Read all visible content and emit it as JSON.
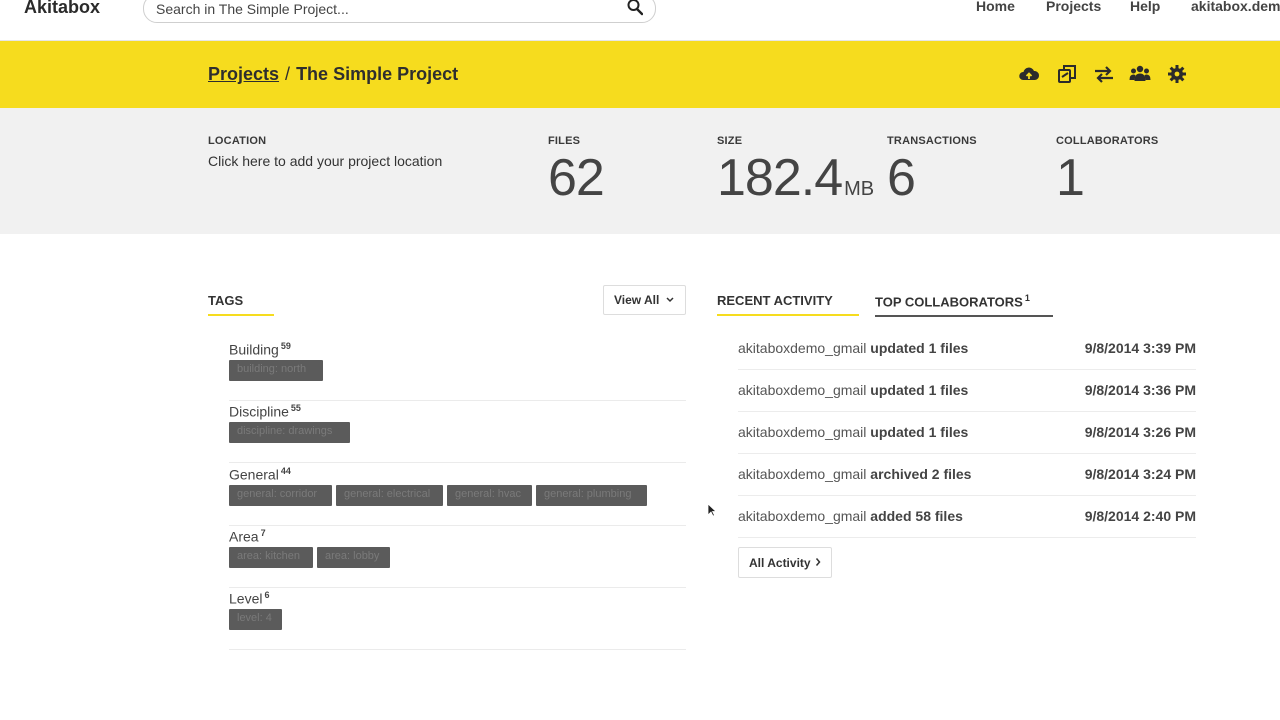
{
  "header": {
    "brand": "Akitabox",
    "search_placeholder": "Search in The Simple Project...",
    "nav": [
      "Home",
      "Projects",
      "Help",
      "akitabox.demo"
    ]
  },
  "breadcrumb": {
    "projects_link": "Projects",
    "separator": "/",
    "current": "The Simple Project"
  },
  "toolbar": {
    "icons": [
      "cloud-upload-icon",
      "copy-icon",
      "transfer-icon",
      "users-icon",
      "gear-icon"
    ]
  },
  "stats": {
    "location_label": "LOCATION",
    "location_value": "Click here to add your project location",
    "files_label": "FILES",
    "files_value": "62",
    "size_label": "SIZE",
    "size_value": "182.4",
    "size_unit": "MB",
    "transactions_label": "TRANSACTIONS",
    "transactions_value": "6",
    "collaborators_label": "COLLABORATORS",
    "collaborators_value": "1"
  },
  "tags": {
    "title": "TAGS",
    "view_all": "View All",
    "groups": [
      {
        "name": "Building",
        "count": "59",
        "chips": [
          "building: north"
        ]
      },
      {
        "name": "Discipline",
        "count": "55",
        "chips": [
          "discipline: drawings"
        ]
      },
      {
        "name": "General",
        "count": "44",
        "chips": [
          "general: corridor",
          "general: electrical",
          "general: hvac",
          "general: plumbing"
        ]
      },
      {
        "name": "Area",
        "count": "7",
        "chips": [
          "area: kitchen",
          "area: lobby"
        ]
      },
      {
        "name": "Level",
        "count": "6",
        "chips": [
          "level: 4"
        ]
      }
    ]
  },
  "activity": {
    "tab_recent": "RECENT ACTIVITY",
    "tab_top": "TOP COLLABORATORS",
    "tab_top_count": "1",
    "rows": [
      {
        "user": "akitaboxdemo_gmail",
        "action": "updated 1 files",
        "time": "9/8/2014 3:39 PM"
      },
      {
        "user": "akitaboxdemo_gmail",
        "action": "updated 1 files",
        "time": "9/8/2014 3:36 PM"
      },
      {
        "user": "akitaboxdemo_gmail",
        "action": "updated 1 files",
        "time": "9/8/2014 3:26 PM"
      },
      {
        "user": "akitaboxdemo_gmail",
        "action": "archived 2 files",
        "time": "9/8/2014 3:24 PM"
      },
      {
        "user": "akitaboxdemo_gmail",
        "action": "added 58 files",
        "time": "9/8/2014 2:40 PM"
      }
    ],
    "all_activity": "All Activity"
  },
  "colors": {
    "accent_yellow": "#f6dc1e",
    "chip_bg": "#5b5b5b",
    "stats_bg": "#f1f1f1"
  }
}
